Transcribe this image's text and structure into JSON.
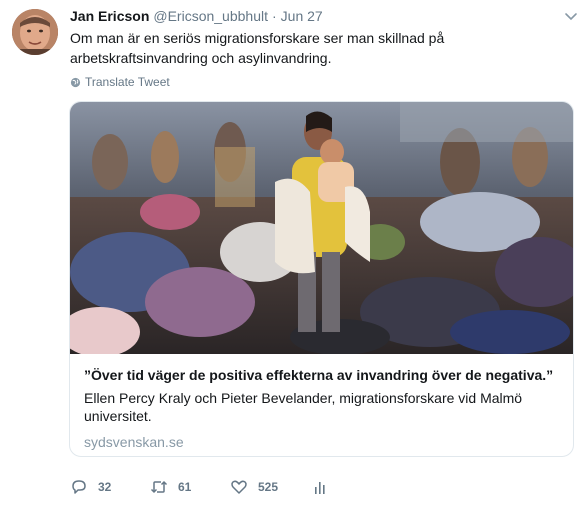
{
  "tweet": {
    "name": "Jan Ericson",
    "handle": "@Ericson_ubbhult",
    "separator": "·",
    "date": "Jun 27",
    "text": "Om man är en seriös migrationsforskare ser man skillnad på arbetskraftsinvandring och asylinvandring.",
    "translate_label": "Translate Tweet",
    "card": {
      "title": "”Över tid väger de positiva effekterna av invandring över de negativa.”",
      "description": "Ellen Percy Kraly och Pieter Bevelander, migrationsforskare vid Malmö universitet.",
      "domain": "sydsvenskan.se"
    },
    "actions": {
      "reply_count": "32",
      "retweet_count": "61",
      "like_count": "525"
    }
  },
  "icons": {
    "caret": "chevron-down-icon",
    "translate": "globe-icon",
    "reply": "reply-icon",
    "retweet": "retweet-icon",
    "like": "heart-icon",
    "stats": "analytics-icon"
  },
  "colors": {
    "text": "#14171a",
    "secondary": "#657786",
    "border": "#e1e8ed",
    "domain": "#8899a6"
  }
}
